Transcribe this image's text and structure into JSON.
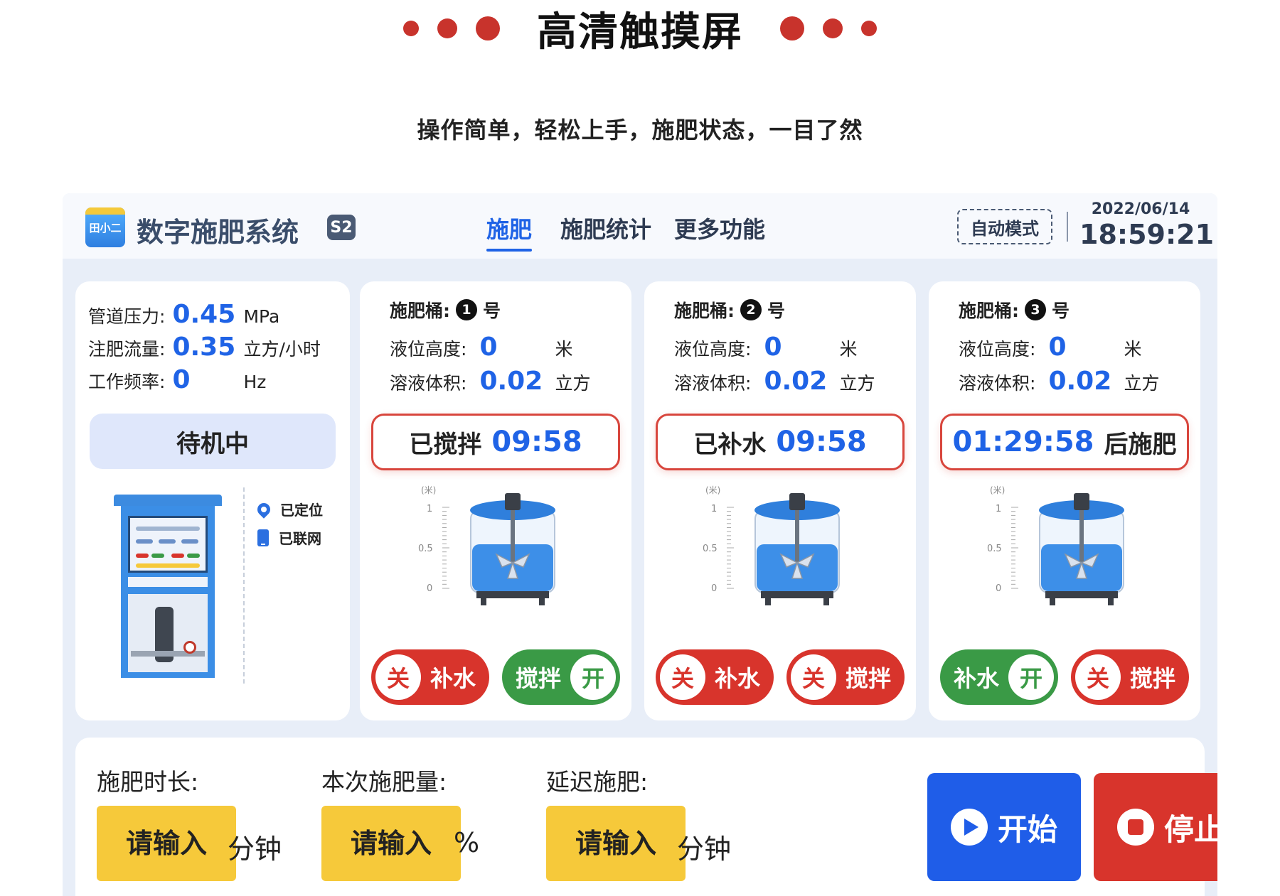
{
  "banner": {
    "title": "高清触摸屏",
    "subtitle": "操作简单，轻松上手，施肥状态，一目了然"
  },
  "app": {
    "logo_text": "田小二",
    "title": "数字施肥系统",
    "version_badge": "S2",
    "tabs": [
      {
        "label": "施肥",
        "active": true
      },
      {
        "label": "施肥统计",
        "active": false
      },
      {
        "label": "更多功能",
        "active": false
      }
    ],
    "mode": "自动模式",
    "date": "2022/06/14",
    "time": "18:59:21"
  },
  "status_panel": {
    "pressure": {
      "label": "管道压力:",
      "value": "0.45",
      "unit": "MPa"
    },
    "flow": {
      "label": "注肥流量:",
      "value": "0.35",
      "unit": "立方/小时"
    },
    "frequency": {
      "label": "工作频率:",
      "value": "0",
      "unit": "Hz"
    },
    "state": "待机中",
    "machine_label": "数字施肥系统",
    "located": "已定位",
    "networked": "已联网"
  },
  "tanks": [
    {
      "title": "施肥桶:",
      "number": "1",
      "suffix": "号",
      "level_label": "液位高度:",
      "level_value": "0",
      "level_unit": "米",
      "volume_label": "溶液体积:",
      "volume_value": "0.02",
      "volume_unit": "立方",
      "timer_prefix": "已搅拌",
      "timer_value": "09:58",
      "timer_suffix": "",
      "scale": {
        "unit": "(米)",
        "top": "1",
        "mid": "0.5",
        "bottom": "0"
      },
      "fill_level": 0.6,
      "refill": {
        "label": "补水",
        "state": "关"
      },
      "stir": {
        "label": "搅拌",
        "state": "开"
      }
    },
    {
      "title": "施肥桶:",
      "number": "2",
      "suffix": "号",
      "level_label": "液位高度:",
      "level_value": "0",
      "level_unit": "米",
      "volume_label": "溶液体积:",
      "volume_value": "0.02",
      "volume_unit": "立方",
      "timer_prefix": "已补水",
      "timer_value": "09:58",
      "timer_suffix": "",
      "scale": {
        "unit": "(米)",
        "top": "1",
        "mid": "0.5",
        "bottom": "0"
      },
      "fill_level": 0.6,
      "refill": {
        "label": "补水",
        "state": "关"
      },
      "stir": {
        "label": "搅拌",
        "state": "关"
      }
    },
    {
      "title": "施肥桶:",
      "number": "3",
      "suffix": "号",
      "level_label": "液位高度:",
      "level_value": "0",
      "level_unit": "米",
      "volume_label": "溶液体积:",
      "volume_value": "0.02",
      "volume_unit": "立方",
      "timer_prefix": "",
      "timer_value": "01:29:58",
      "timer_suffix": "后施肥",
      "scale": {
        "unit": "(米)",
        "top": "1",
        "mid": "0.5",
        "bottom": "0"
      },
      "fill_level": 0.6,
      "refill": {
        "label": "补水",
        "state": "开"
      },
      "stir": {
        "label": "搅拌",
        "state": "关"
      }
    }
  ],
  "controls": {
    "duration": {
      "label": "施肥时长:",
      "placeholder": "请输入",
      "unit": "分钟"
    },
    "amount": {
      "label": "本次施肥量:",
      "placeholder": "请输入",
      "unit": "%"
    },
    "delay": {
      "label": "延迟施肥:",
      "placeholder": "请输入",
      "unit": "分钟"
    },
    "start_label": "开始",
    "stop_label": "停止"
  },
  "colors": {
    "accent_blue": "#1f63e6",
    "alert_red": "#d8342c",
    "on_green": "#3a9a46",
    "input_yellow": "#f6c93a",
    "banner_dot": "#c8332c"
  }
}
